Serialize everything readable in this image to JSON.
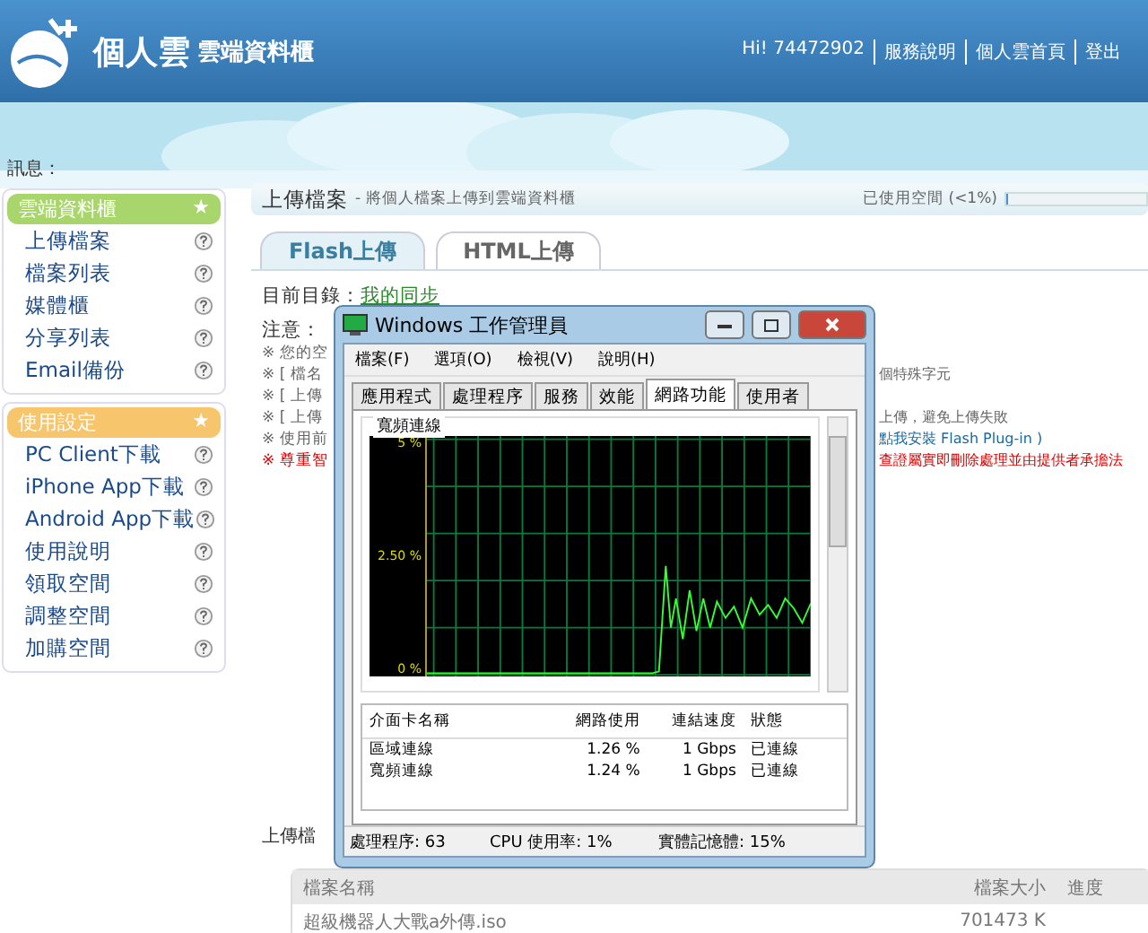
{
  "header": {
    "brand": "個人雲",
    "subtitle": "雲端資料櫃",
    "links": [
      "Hi! 74472902",
      "服務說明",
      "個人雲首頁",
      "登出"
    ]
  },
  "message_label": "訊息：",
  "sidebar": [
    {
      "title": "雲端資料櫃",
      "star": "★",
      "color": "#a8d66c",
      "items": [
        "上傳檔案",
        "檔案列表",
        "媒體櫃",
        "分享列表",
        "Email備份"
      ]
    },
    {
      "title": "使用設定",
      "star": "★",
      "color": "#f6c56c",
      "items": [
        "PC Client下載",
        "iPhone App下載",
        "Android App下載",
        "使用說明",
        "領取空間",
        "調整空間",
        "加購空間"
      ]
    }
  ],
  "page": {
    "title": "上傳檔案",
    "subtitle": "- 將個人檔案上傳到雲端資料櫃",
    "usage_label": "已使用空間 (<1%)",
    "usage": {
      "level": 0.01
    },
    "tabs": [
      {
        "label": "Flash上傳",
        "selected": true
      },
      {
        "label": "HTML上傳",
        "selected": false
      }
    ],
    "dir_label": "目前目錄：",
    "dir_link": "我的同步",
    "notes_label": "注意：",
    "notes": [
      {
        "start": "※ 您的空",
        "warning": false
      },
      {
        "start": "※ [ 檔名",
        "end": "個特殊字元",
        "warning": false
      },
      {
        "start": "※ [ 上傳",
        "warning": false
      },
      {
        "start": "※ [ 上傳",
        "end": "上傳，避免上傳失敗",
        "warning": false
      },
      {
        "start": "※ 使用前",
        "end": "點我安裝 Flash Plug-in )",
        "end_link": true,
        "warning": false
      },
      {
        "start": "※ 尊重智",
        "end": "查證屬實即刪除處理並由提供者承擔法",
        "warning": true
      }
    ],
    "list_label": "上傳檔",
    "table": {
      "columns": [
        "檔案名稱",
        "檔案大小",
        "進度"
      ],
      "rows": [
        [
          "超級機器人大戰a外傳.iso",
          "701473 K"
        ]
      ]
    }
  },
  "task_manager": {
    "title": "Windows 工作管理員",
    "menu": [
      "檔案(F)",
      "選項(O)",
      "檢視(V)",
      "說明(H)"
    ],
    "tabs": [
      {
        "label": "應用程式",
        "selected": false
      },
      {
        "label": "處理程序",
        "selected": false
      },
      {
        "label": "服務",
        "selected": false
      },
      {
        "label": "效能",
        "selected": false
      },
      {
        "label": "網路功能",
        "selected": true
      },
      {
        "label": "使用者",
        "selected": false
      }
    ],
    "graph_title": "寬頻連線",
    "graph_labels": [
      "5 %",
      "2.50 %",
      "0 %"
    ],
    "columns": [
      "介面卡名稱",
      "網路使用",
      "連結速度",
      "狀態"
    ],
    "rows": [
      [
        "區域連線",
        "1.26 %",
        "1 Gbps",
        "已連線"
      ],
      [
        "寬頻連線",
        "1.24 %",
        "1 Gbps",
        "已連線"
      ]
    ],
    "status": [
      "處理程序: 63",
      "CPU 使用率: 1%",
      "實體記憶體: 15%"
    ]
  }
}
